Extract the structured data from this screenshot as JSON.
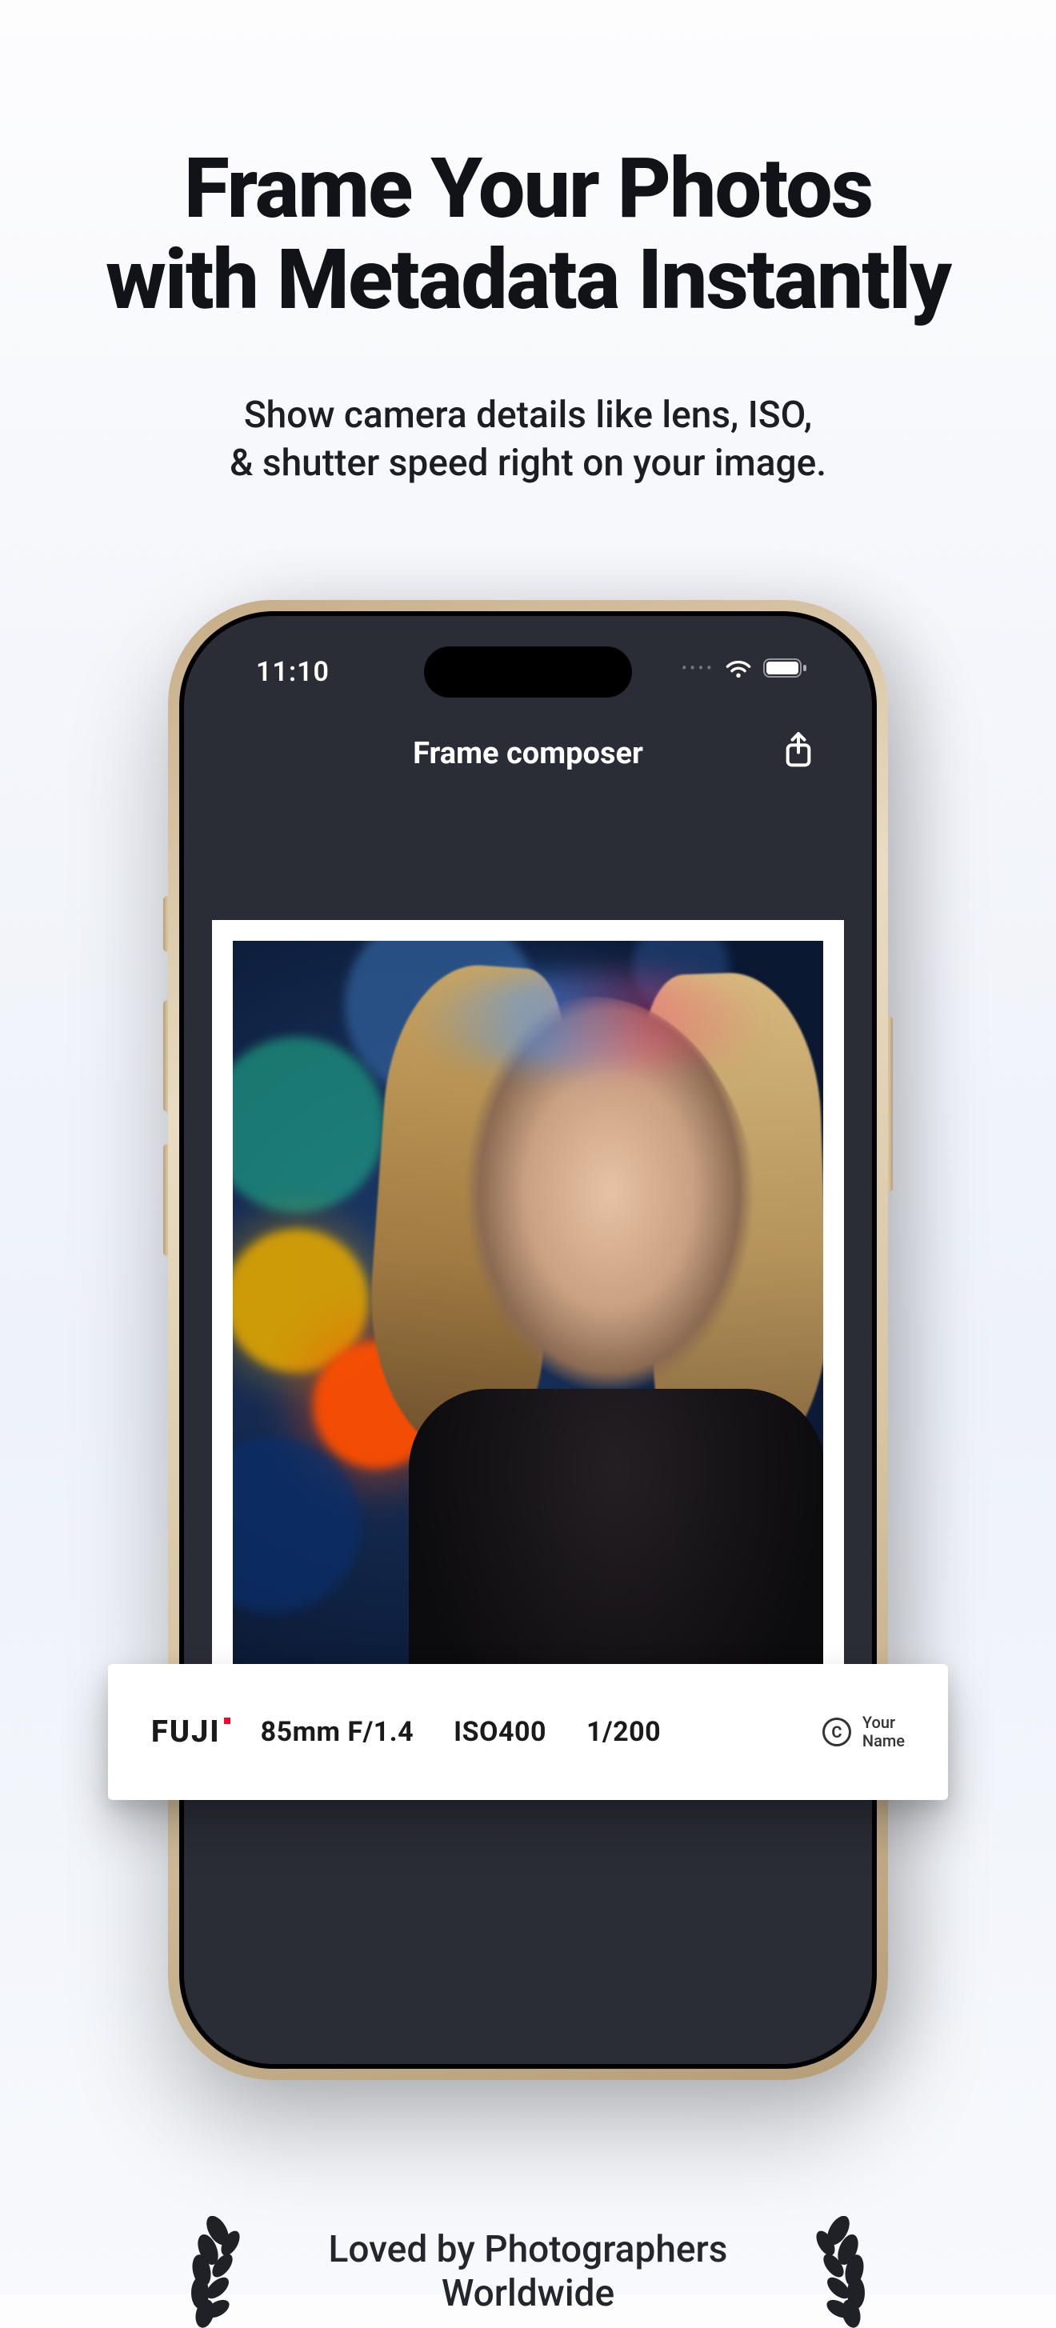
{
  "hero": {
    "title_line1": "Frame Your Photos",
    "title_line2": "with Metadata Instantly",
    "subtitle_line1": "Show camera details like lens, ISO,",
    "subtitle_line2": "& shutter speed right on your image."
  },
  "statusbar": {
    "time": "11:10"
  },
  "navbar": {
    "title": "Frame composer"
  },
  "metadata_strip": {
    "brand": "FUJI",
    "lens": "85mm F/1.4",
    "iso": "ISO400",
    "shutter": "1/200",
    "copyright_symbol": "C",
    "copyright_line1": "Your",
    "copyright_line2": "Name"
  },
  "footer": {
    "line1": "Loved by Photographers",
    "line2": "Worldwide"
  }
}
